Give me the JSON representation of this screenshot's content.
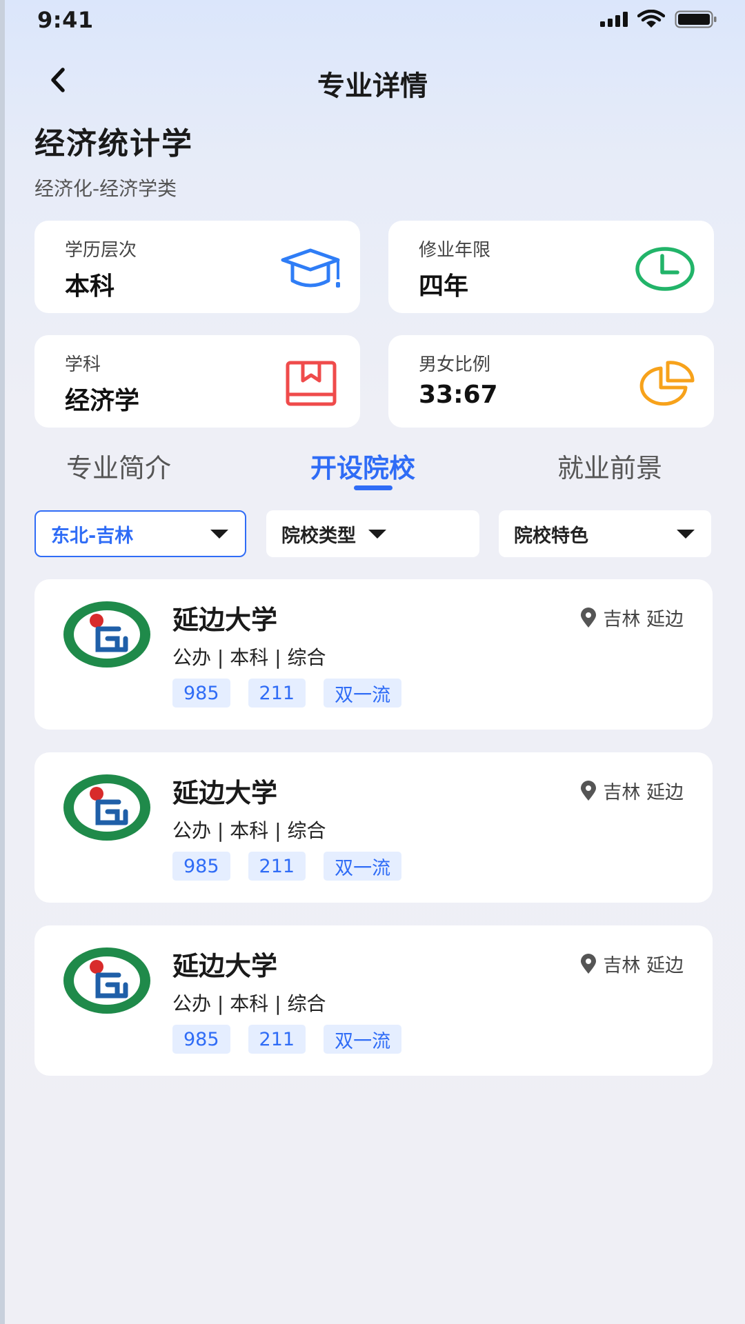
{
  "status_bar": {
    "time": "9:41"
  },
  "nav": {
    "title": "专业详情"
  },
  "major": {
    "name": "经济统计学",
    "category": "经济化-经济学类"
  },
  "info_cards": [
    {
      "label": "学历层次",
      "value": "本科",
      "icon": "graduation-cap-icon",
      "color": "#2f7df6"
    },
    {
      "label": "修业年限",
      "value": "四年",
      "icon": "clock-icon",
      "color": "#22b469"
    },
    {
      "label": "学科",
      "value": "经济学",
      "icon": "book-icon",
      "color": "#ef4b4b"
    },
    {
      "label": "男女比例",
      "value": "33:67",
      "icon": "pie-chart-icon",
      "color": "#f7a21b"
    }
  ],
  "tabs": [
    {
      "label": "专业简介",
      "active": false
    },
    {
      "label": "开设院校",
      "active": true
    },
    {
      "label": "就业前景",
      "active": false
    }
  ],
  "filters": [
    {
      "label": "东北-吉林",
      "active": true
    },
    {
      "label": "院校类型",
      "active": false
    },
    {
      "label": "院校特色",
      "active": false
    }
  ],
  "schools": [
    {
      "name": "延边大学",
      "attrs": "公办 | 本科 | 综合",
      "location": "吉林 延边",
      "tags": [
        "985",
        "211",
        "双一流"
      ]
    },
    {
      "name": "延边大学",
      "attrs": "公办 | 本科 | 综合",
      "location": "吉林 延边",
      "tags": [
        "985",
        "211",
        "双一流"
      ]
    },
    {
      "name": "延边大学",
      "attrs": "公办 | 本科 | 综合",
      "location": "吉林 延边",
      "tags": [
        "985",
        "211",
        "双一流"
      ]
    }
  ],
  "colors": {
    "accent": "#2f6cf6",
    "tag_bg": "#e5eeff",
    "logo_green": "#1f8a4a",
    "logo_red": "#d82b2b"
  }
}
